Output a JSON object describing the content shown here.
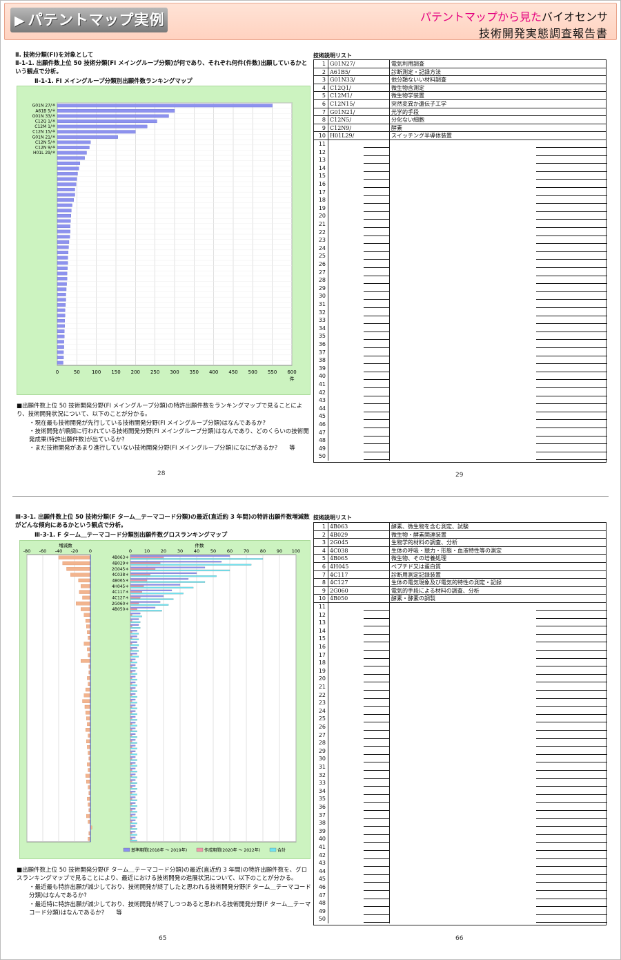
{
  "header": {
    "left_title": "パテントマップ実例",
    "right_line1_pink": "パテントマップから見た",
    "right_line1_black": "バイオセンサ",
    "right_line2": "技術開発実態調査報告書"
  },
  "top": {
    "section_heading": "Ⅱ. 技術分類(FI)を対象として",
    "subheading": "Ⅱ-1-1. 出願件数上位 50 技術分類(FI メイングループ分類)が何であり、それぞれ何件(件数)出願しているかという観点で分析。",
    "chart_title": "Ⅱ-1-1. FI メイングループ分類別出願件数ランキングマップ",
    "axis_unit": "件",
    "notes": [
      "■出願件数上位 50 技術開発分野(FI メイングループ分類)の特許出願件数をランキングマップで見ることにより、技術開発状況について、以下のことが分かる。",
      "・現在最も技術開発が先行している技術開発分野(FI メイングループ分類)はなんであるか?",
      "・技術開発が順調に行われている技術開発分野(FI メイングループ分類)はなんであり、どのくらいの技術開発成果(特許出願件数)が出ているか?",
      "・まだ技術開発があまり進行していない技術開発分野(FI メイングループ分類)になにがあるか?　　等"
    ],
    "page_left": "28",
    "page_right": "29",
    "list_title": "技術説明リスト",
    "list": [
      {
        "n": "1",
        "code": "G01N27/",
        "desc": "電気利用調査"
      },
      {
        "n": "2",
        "code": "A61B5/",
        "desc": "診断測定・記録方法"
      },
      {
        "n": "3",
        "code": "G01N33/",
        "desc": "他分類ないい材料調査"
      },
      {
        "n": "4",
        "code": "C12Q1/",
        "desc": "微生物含測定"
      },
      {
        "n": "5",
        "code": "C12M1/",
        "desc": "微生物学装置"
      },
      {
        "n": "6",
        "code": "C12N15/",
        "desc": "突然変異か遺伝子工学"
      },
      {
        "n": "7",
        "code": "G01N21/",
        "desc": "光学的手段"
      },
      {
        "n": "8",
        "code": "C12N5/",
        "desc": "分化ない細胞"
      },
      {
        "n": "9",
        "code": "C12N9/",
        "desc": "酵素"
      },
      {
        "n": "10",
        "code": "H01L29/",
        "desc": "スイッチング半導体装置"
      }
    ]
  },
  "bottom": {
    "heading": "Ⅲ-3-1. 出願件数上位 50 技術分類(F ターム＿テーマコード分類)の最近(直近約 3 年間)の特許出願件数増減数がどんな傾向にあるかという観点で分析。",
    "chart_title": "Ⅲ-3-1. F ターム＿テーマコード分類別出願件数グロスランキングマップ",
    "left_axis_title": "増減数",
    "right_axis_title": "件数",
    "legend": [
      {
        "label": "基準期間(2018年 ～ 2019年)",
        "color": "#8a8ff0"
      },
      {
        "label": "作成期間(2020年 ～ 2022年)",
        "color": "#f09aa8"
      },
      {
        "label": "合計",
        "color": "#6fe3f0"
      }
    ],
    "notes": [
      "■出願件数上位 50 技術開発分野(F ターム＿テーマコード分類)の最近(直近約 3 年間)の特許出願件数を、グロスランキングマップで見ることにより、最近における技術開発の進展状況について、以下のことが分かる。",
      "・最近最も特許出願が減少しており、技術開発が終了したと思われる技術開発分野(F ターム＿テーマコード分類)はなんであるか?",
      "・最近特に特許出願が減少しており、技術開発が終了しつつあると思われる技術開発分野(F ターム＿テーマコード分類)はなんであるか?　　等"
    ],
    "page_left": "65",
    "page_right": "66",
    "list_title": "技術説明リスト",
    "list": [
      {
        "n": "1",
        "code": "4B063",
        "desc": "酵素、微生物を含む測定、試験"
      },
      {
        "n": "2",
        "code": "4B029",
        "desc": "微生物・酵素関連装置"
      },
      {
        "n": "3",
        "code": "2G045",
        "desc": "生物学的材料の調査、分析"
      },
      {
        "n": "4",
        "code": "4C038",
        "desc": "生体の呼吸・聴力・形態・血液特性等の測定"
      },
      {
        "n": "5",
        "code": "4B065",
        "desc": "微生物、その培養処理"
      },
      {
        "n": "6",
        "code": "4H045",
        "desc": "ペプチド又は蛋白質"
      },
      {
        "n": "7",
        "code": "4C117",
        "desc": "診断用測定記録装置"
      },
      {
        "n": "8",
        "code": "4C127",
        "desc": "生体の電気現象及び電気的特性の測定・記録"
      },
      {
        "n": "9",
        "code": "2G060",
        "desc": "電気的手段による材料の調査、分析"
      },
      {
        "n": "10",
        "code": "4B050",
        "desc": "酵素・酵素の調製"
      }
    ]
  },
  "chart_data": [
    {
      "type": "bar",
      "orientation": "horizontal",
      "categories": [
        "G01N 27/＊",
        "A61B 5/＊",
        "G01N 33/＊",
        "C12Q 1/＊",
        "C12M 1/＊",
        "C12N 15/＊",
        "G01N 21/＊",
        "C12N 5/＊",
        "C12N 9/＊",
        "H01L 29/＊"
      ],
      "values": [
        550,
        300,
        285,
        255,
        230,
        200,
        155,
        85,
        82,
        75,
        70,
        58,
        55,
        52,
        50,
        48,
        45,
        45,
        42,
        38,
        36,
        35,
        34,
        33,
        33,
        32,
        30,
        29,
        28,
        27,
        27,
        26,
        25,
        25,
        24,
        23,
        22,
        22,
        21,
        20,
        20,
        19,
        19,
        18,
        18,
        17,
        17,
        16,
        16,
        15
      ],
      "xlim": [
        0,
        600
      ],
      "xticks": [
        "0",
        "50",
        "100",
        "150",
        "200",
        "250",
        "300",
        "350",
        "400",
        "450",
        "500",
        "550",
        "600"
      ],
      "xlabel": "件",
      "grid": true
    },
    {
      "type": "bar",
      "orientation": "horizontal",
      "categories": [
        "4B063＊",
        "4B029＊",
        "2G045＊",
        "4C038＊",
        "4B065＊",
        "4H045＊",
        "4C117＊",
        "4C127＊",
        "2G060＊",
        "4B050＊"
      ],
      "left_panel": {
        "title": "増減数",
        "xlim": [
          -80,
          0
        ],
        "xticks": [
          "-80",
          "-60",
          "-40",
          "-20",
          "0"
        ],
        "values": [
          -40,
          -35,
          -30,
          -25,
          -15,
          -12,
          -14,
          -10,
          -18,
          -12,
          -8,
          -6,
          -5,
          -4,
          -3,
          -8,
          -4,
          -3,
          -12,
          -2,
          -2,
          -4,
          -3,
          -6,
          -8,
          -10,
          -7,
          -6,
          -5,
          -4,
          -6,
          -3,
          -5,
          -4,
          -3,
          -2,
          -4,
          -3,
          -6,
          -5,
          -3,
          -2,
          -4,
          -3,
          -2,
          -5,
          -3,
          2,
          -2,
          -3
        ]
      },
      "right_panel": {
        "title": "件数",
        "xlim": [
          0,
          100
        ],
        "xticks": [
          "0",
          "10",
          "20",
          "30",
          "40",
          "50",
          "60",
          "70",
          "80",
          "90",
          "100"
        ],
        "series": [
          {
            "name": "基準期間(2018年 ～ 2019年)",
            "values": [
              60,
              55,
              45,
              40,
              35,
              30,
              25,
              20,
              18,
              15,
              6,
              5,
              5,
              4,
              4,
              4,
              4,
              4,
              3,
              3,
              3,
              3,
              3,
              3,
              3,
              3,
              3,
              3,
              3,
              3,
              3,
              3,
              3,
              3,
              3,
              3,
              3,
              3,
              3,
              3,
              3,
              3,
              3,
              3,
              3,
              3,
              3,
              3,
              3,
              3
            ]
          },
          {
            "name": "作成期間(2020年 ～ 2022年)",
            "values": [
              20,
              18,
              15,
              12,
              10,
              8,
              7,
              6,
              5,
              4,
              1,
              1,
              1,
              1,
              1,
              1,
              1,
              1,
              1,
              1,
              1,
              1,
              1,
              1,
              1,
              1,
              1,
              1,
              1,
              1,
              1,
              1,
              1,
              1,
              1,
              1,
              1,
              1,
              1,
              1,
              1,
              1,
              1,
              1,
              1,
              1,
              1,
              1,
              1,
              1
            ]
          },
          {
            "name": "合計",
            "values": [
              80,
              73,
              60,
              52,
              45,
              38,
              32,
              26,
              23,
              19,
              7,
              6,
              6,
              5,
              5,
              5,
              5,
              5,
              4,
              4,
              4,
              4,
              4,
              4,
              4,
              4,
              4,
              4,
              4,
              4,
              4,
              4,
              4,
              4,
              4,
              4,
              4,
              4,
              4,
              4,
              4,
              4,
              4,
              4,
              4,
              4,
              4,
              4,
              4,
              4
            ]
          }
        ]
      },
      "grid": true,
      "legend": "bottom"
    }
  ]
}
